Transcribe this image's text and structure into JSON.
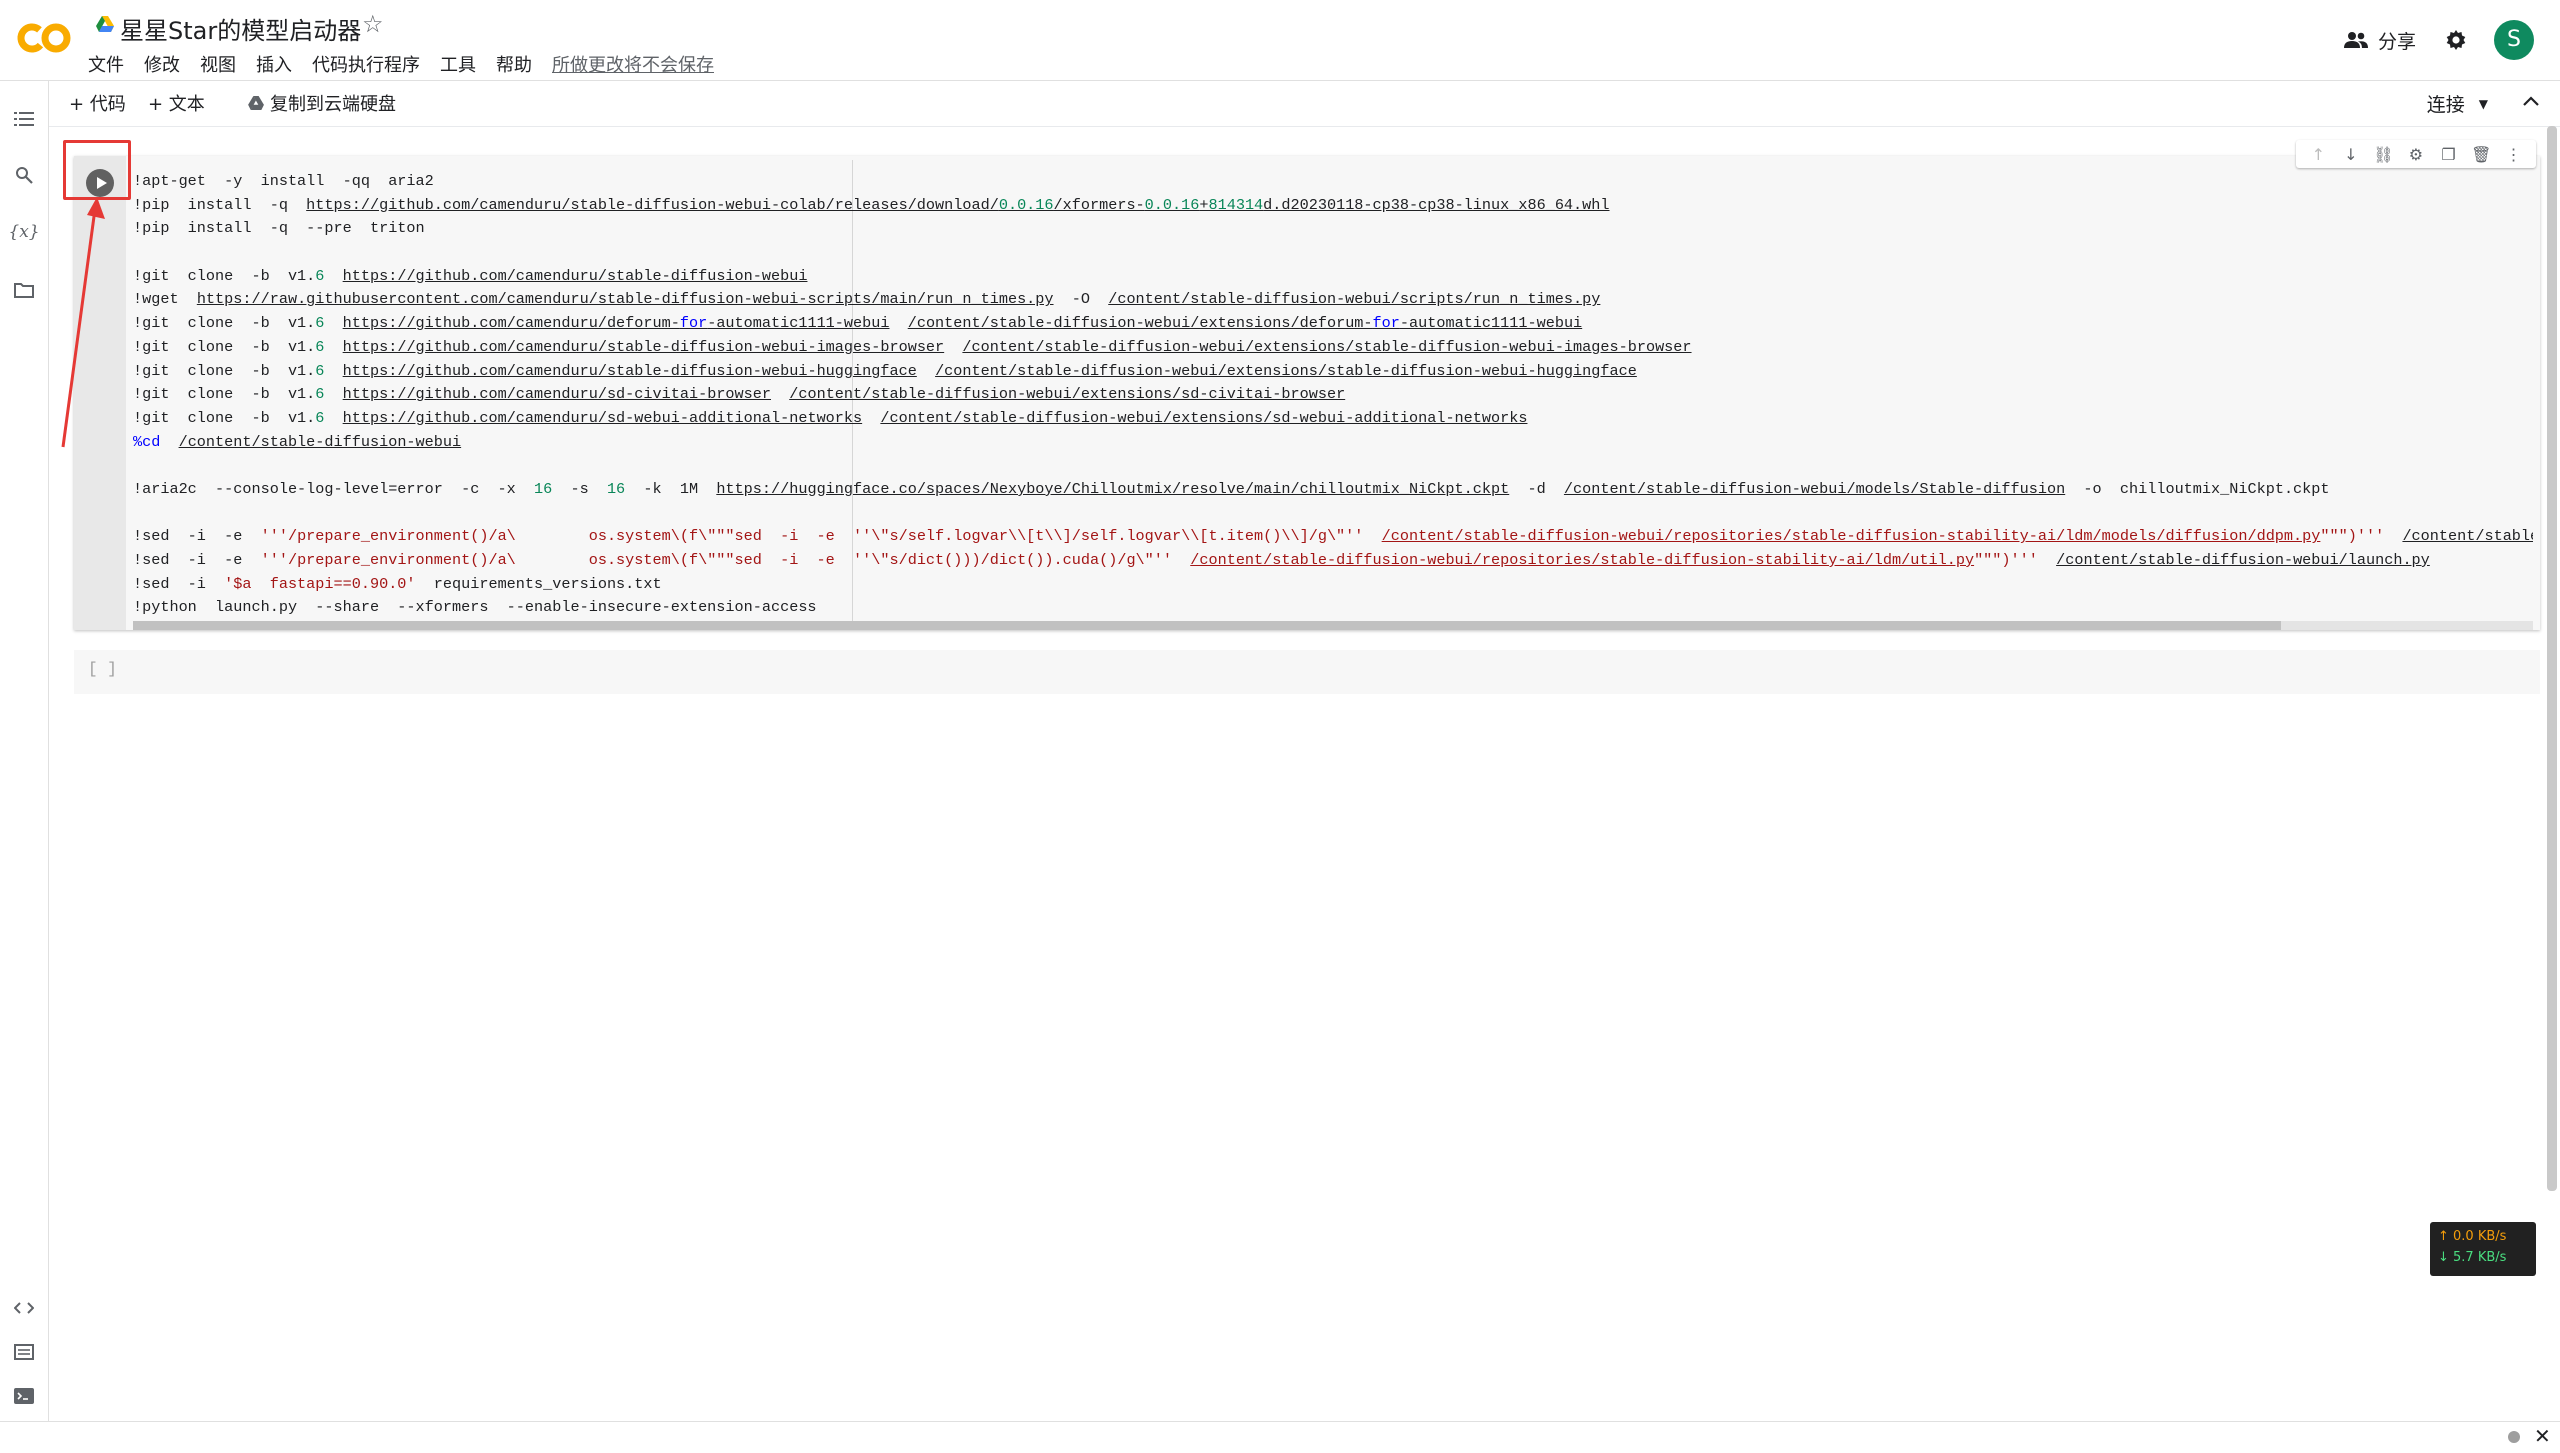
{
  "header": {
    "title": "星星Star的模型启动器",
    "star_icon": "star-outline-icon",
    "menu": [
      "文件",
      "修改",
      "视图",
      "插入",
      "代码执行程序",
      "工具",
      "帮助"
    ],
    "unsaved_notice": "所做更改将不会保存",
    "share_label": "分享",
    "avatar_letter": "S"
  },
  "toolbar": {
    "add_code": "+ 代码",
    "add_text": "+ 文本",
    "copy_drive": "复制到云端硬盘",
    "connect": "连接"
  },
  "sidebar": {
    "icons": [
      "table-of-contents-icon",
      "search-icon",
      "variables-icon",
      "files-icon",
      "code-snippets-icon",
      "command-palette-icon",
      "terminal-icon"
    ],
    "variables_glyph": "{x}"
  },
  "cell": {
    "tools": [
      "move-up-icon",
      "move-down-icon",
      "link-icon",
      "settings-icon",
      "mirror-cell-icon",
      "delete-icon",
      "more-icon"
    ]
  },
  "output": {
    "bracket": "[ ]"
  },
  "net": {
    "up": "↑ 0.0 KB/s",
    "down": "↓ 5.7 KB/s"
  },
  "colors": {
    "accent_orange": "#f9ab00",
    "highlight_red": "#e53935",
    "avatar_green": "#0f8a5f"
  }
}
